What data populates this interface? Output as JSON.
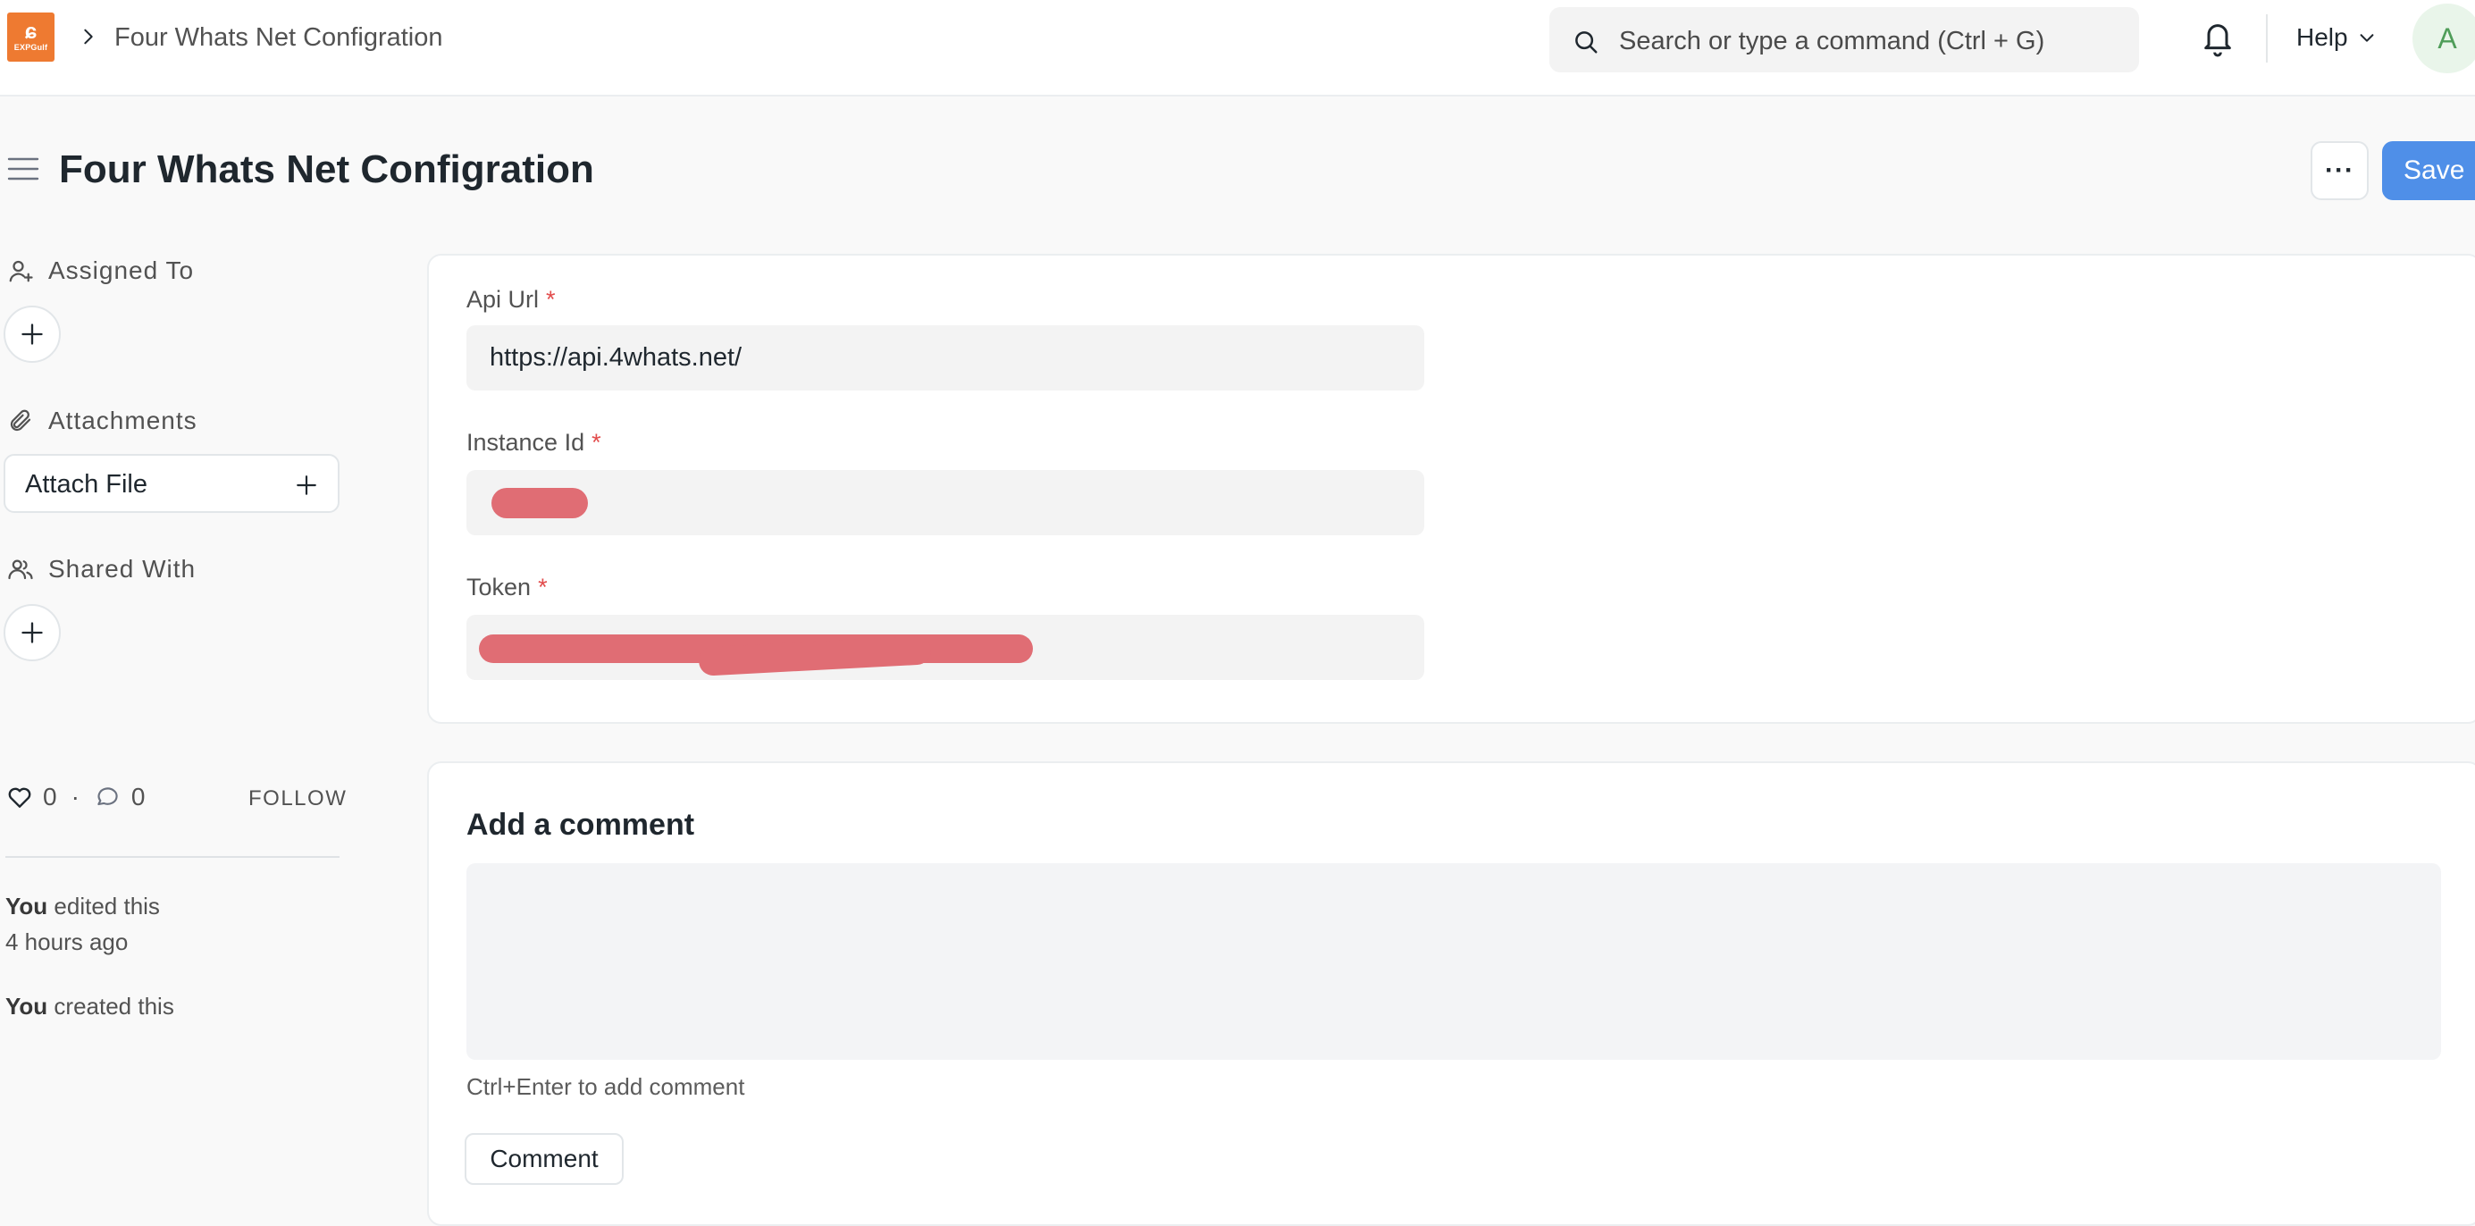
{
  "navbar": {
    "logo_text": "EXPGulf",
    "breadcrumb": "Four Whats Net Configration",
    "search_placeholder": "Search or type a command (Ctrl + G)",
    "help_label": "Help",
    "avatar_initial": "A"
  },
  "page": {
    "title": "Four Whats Net Configration",
    "more_label": "···",
    "save_label": "Save"
  },
  "sidebar": {
    "assigned_to": "Assigned To",
    "attachments": "Attachments",
    "attach_file": "Attach File",
    "shared_with": "Shared With",
    "likes": "0",
    "comments": "0",
    "follow": "FOLLOW",
    "activity": [
      {
        "who": "You",
        "what": " edited this",
        "when": "4 hours ago"
      },
      {
        "who": "You",
        "what": " created this",
        "when": ""
      }
    ]
  },
  "form": {
    "api_url": {
      "label": "Api Url",
      "value": "https://api.4whats.net/"
    },
    "instance_id": {
      "label": "Instance Id",
      "value": ""
    },
    "token": {
      "label": "Token",
      "value": ""
    },
    "required_mark": "*"
  },
  "comment": {
    "title": "Add a comment",
    "hint": "Ctrl+Enter to add comment",
    "button": "Comment"
  },
  "colors": {
    "primary": "#4f8fe8",
    "logo": "#ee7a31",
    "required": "#e24c4c",
    "redaction": "#e06d74"
  }
}
